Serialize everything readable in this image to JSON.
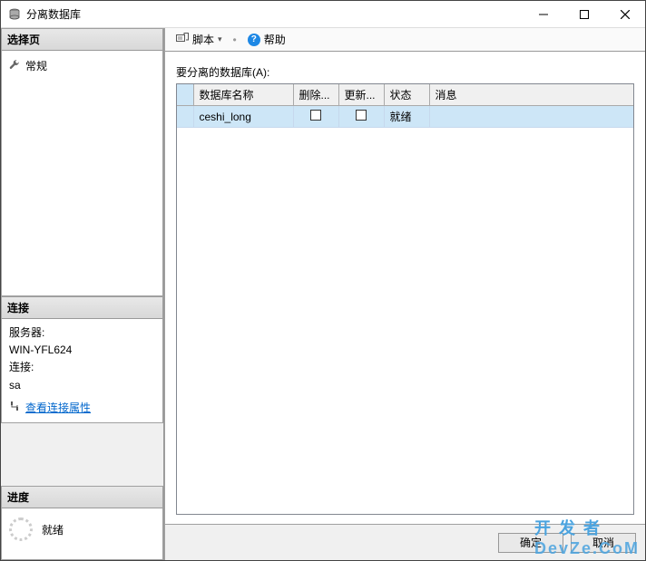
{
  "titlebar": {
    "title": "分离数据库"
  },
  "sidebar": {
    "selectpage": {
      "header": "选择页",
      "general": "常规"
    },
    "connection": {
      "header": "连接",
      "server_label": "服务器:",
      "server_value": "WIN-YFL624",
      "conn_label": "连接:",
      "conn_value": "sa",
      "view_link": "查看连接属性"
    },
    "progress": {
      "header": "进度",
      "status": "就绪"
    }
  },
  "toolbar": {
    "script": "脚本",
    "help": "帮助"
  },
  "content": {
    "section_label": "要分离的数据库(A):",
    "headers": {
      "name": "数据库名称",
      "drop": "删除...",
      "update": "更新...",
      "status": "状态",
      "message": "消息"
    },
    "rows": [
      {
        "name": "ceshi_long",
        "drop_checked": false,
        "update_checked": false,
        "status": "就绪",
        "message": ""
      }
    ]
  },
  "footer": {
    "ok": "确定",
    "cancel": "取消"
  },
  "watermark": {
    "line1": "开 发 者",
    "line2": "DevZe.CoM"
  }
}
